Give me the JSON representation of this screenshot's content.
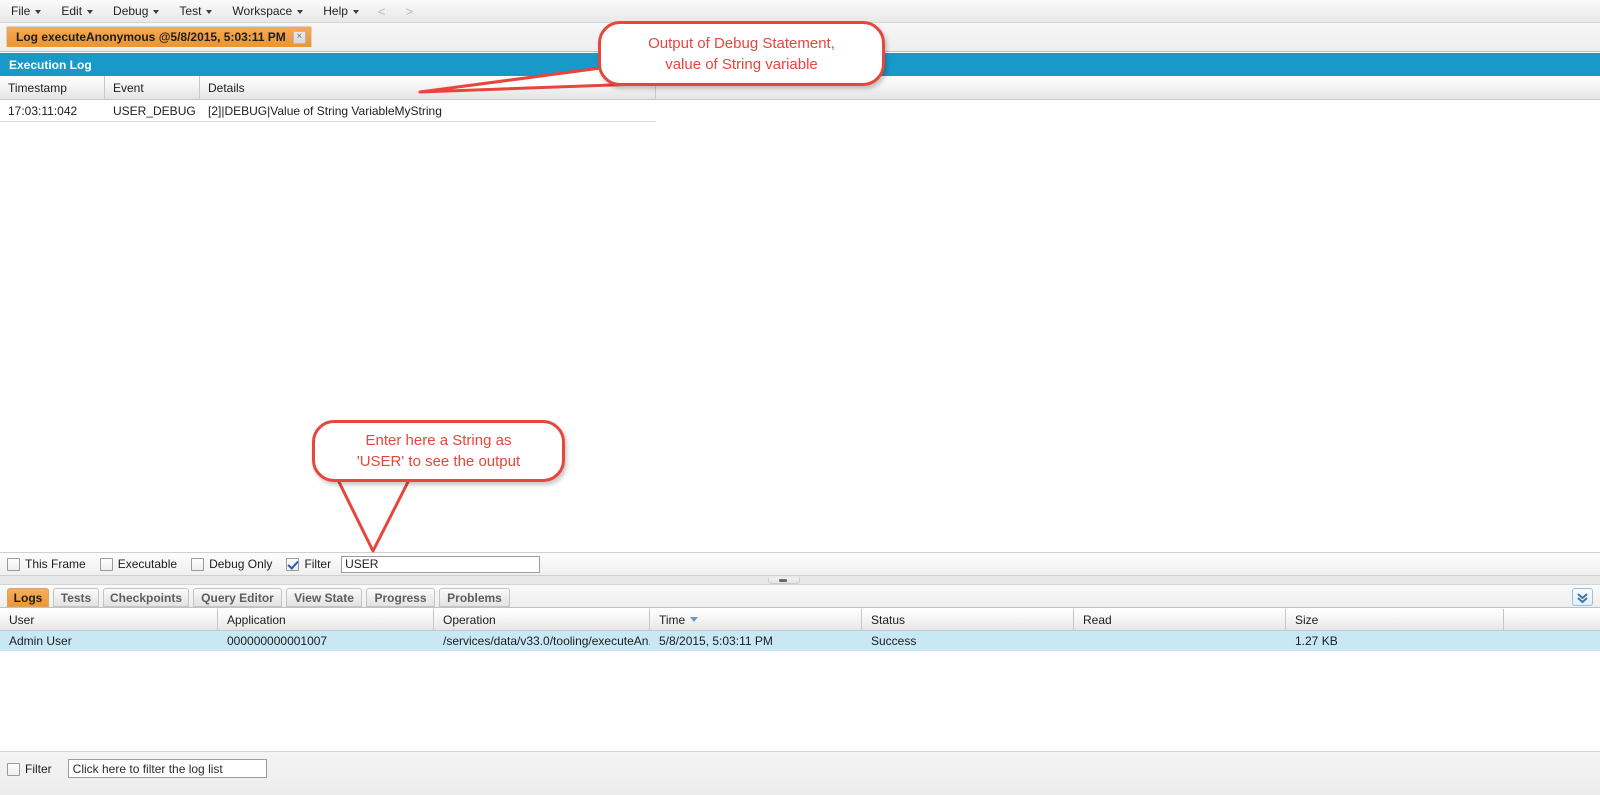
{
  "menubar": {
    "items": [
      {
        "label": "File",
        "has_caret": true
      },
      {
        "label": "Edit",
        "has_caret": true
      },
      {
        "label": "Debug",
        "has_caret": true
      },
      {
        "label": "Test",
        "has_caret": true
      },
      {
        "label": "Workspace",
        "has_caret": true
      },
      {
        "label": "Help",
        "has_caret": true
      }
    ],
    "nav_back": "<",
    "nav_forward": ">"
  },
  "doctab": {
    "label": "Log executeAnonymous @5/8/2015, 5:03:11 PM",
    "close": "×"
  },
  "exec_log": {
    "title": "Execution Log",
    "title_bg": "#1899c8",
    "columns": [
      "Timestamp",
      "Event",
      "Details"
    ],
    "rows": [
      {
        "timestamp": "17:03:11:042",
        "event": "USER_DEBUG",
        "details": "[2]|DEBUG|Value of String VariableMyString"
      }
    ]
  },
  "log_filter_bar": {
    "this_frame": {
      "label": "This Frame",
      "checked": false
    },
    "executable": {
      "label": "Executable",
      "checked": false
    },
    "debug_only": {
      "label": "Debug Only",
      "checked": false
    },
    "filter": {
      "label": "Filter",
      "checked": true
    },
    "filter_value": "USER",
    "filter_placeholder": ""
  },
  "bottom_tabs": {
    "items": [
      {
        "label": "Logs",
        "active": true
      },
      {
        "label": "Tests",
        "active": false
      },
      {
        "label": "Checkpoints",
        "active": false
      },
      {
        "label": "Query Editor",
        "active": false
      },
      {
        "label": "View State",
        "active": false
      },
      {
        "label": "Progress",
        "active": false
      },
      {
        "label": "Problems",
        "active": false
      }
    ],
    "expand_icon": "chevron-double-down"
  },
  "log_list": {
    "columns": [
      "User",
      "Application",
      "Operation",
      "Time",
      "Status",
      "Read",
      "Size"
    ],
    "sorted_column": "Time",
    "sort_direction": "desc",
    "rows": [
      {
        "user": "Admin User",
        "application": "000000000001007",
        "operation": "/services/data/v33.0/tooling/executeAn...",
        "time": "5/8/2015, 5:03:11 PM",
        "status": "Success",
        "read": "",
        "size": "1.27 KB"
      }
    ]
  },
  "bottom_filter": {
    "label": "Filter",
    "checked": false,
    "value": "",
    "placeholder": "Click here to filter the log list"
  },
  "callouts": [
    {
      "id": "debug-output",
      "line1": "Output of Debug Statement,",
      "line2": "value of String variable",
      "color": "#e8453c"
    },
    {
      "id": "filter-hint",
      "line1": "Enter here a String as",
      "line2": "'USER' to see the output",
      "color": "#e8453c"
    }
  ]
}
